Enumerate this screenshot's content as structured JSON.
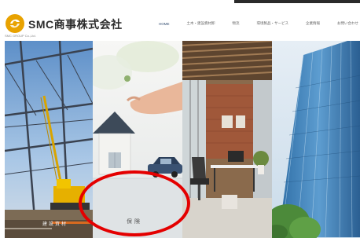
{
  "brand": {
    "name": "SMC商事株式会社",
    "tagline": "SMC GROUP Co.,Ltd."
  },
  "nav": {
    "items": [
      {
        "label": "HOME",
        "active": true
      },
      {
        "label": "土木・建設資材卸"
      },
      {
        "label": "物流"
      },
      {
        "label": "環境製品・サービス"
      },
      {
        "label": "企業情報"
      },
      {
        "label": "お問い合わせ"
      }
    ]
  },
  "panels": [
    {
      "caption": "建設資材",
      "icon": "crane-construction"
    },
    {
      "caption": "保険",
      "icon": "house-car-hand"
    },
    {
      "caption": "",
      "icon": "office-interior"
    },
    {
      "caption": "",
      "icon": "skyscraper"
    }
  ],
  "colors": {
    "accent": "#e8a200",
    "nav_active": "#2f4a6e",
    "annotation": "#e40000"
  }
}
